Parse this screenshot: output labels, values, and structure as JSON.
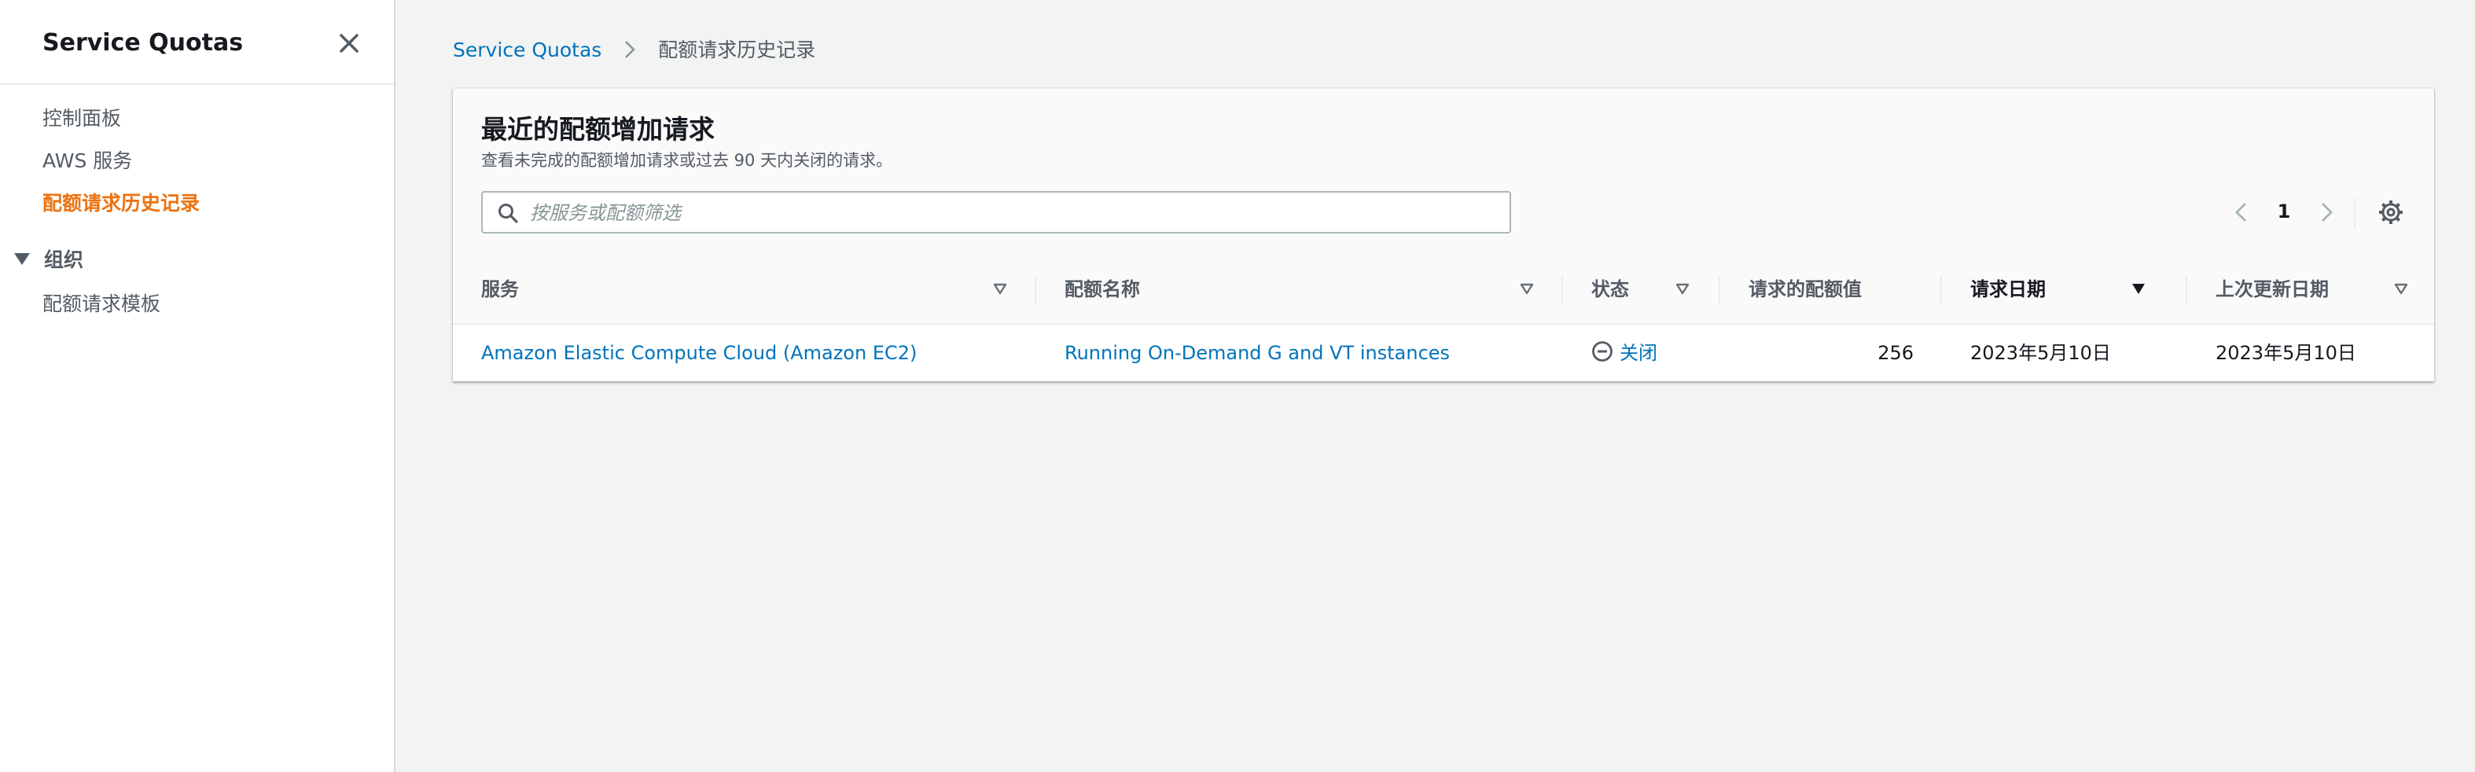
{
  "sidebar": {
    "title": "Service Quotas",
    "links": [
      "控制面板",
      "AWS 服务",
      "配额请求历史记录"
    ],
    "active_index": 2,
    "group_label": "组织",
    "group_links": [
      "配额请求模板"
    ]
  },
  "breadcrumb": {
    "root": "Service Quotas",
    "current": "配额请求历史记录"
  },
  "panel": {
    "title": "最近的配额增加请求",
    "description": "查看未完成的配额增加请求或过去 90 天内关闭的请求。",
    "search_placeholder": "按服务或配额筛选",
    "search_value": "",
    "page": "1"
  },
  "table": {
    "columns": [
      "服务",
      "配额名称",
      "状态",
      "请求的配额值",
      "请求日期",
      "上次更新日期"
    ],
    "sorted_column": "请求日期",
    "rows": [
      {
        "service": "Amazon Elastic Compute Cloud (Amazon EC2)",
        "quota_name": "Running On-Demand G and VT instances",
        "status": "关闭",
        "requested_value": "256",
        "request_date": "2023年5月10日",
        "last_updated": "2023年5月10日"
      }
    ]
  },
  "colors": {
    "link": "#0073bb",
    "active_nav": "#ec7211",
    "muted_text": "#545b64",
    "background": "#f2f3f3"
  },
  "icons": [
    "close-icon",
    "chevron-right-icon",
    "caret-down-icon",
    "search-icon",
    "chevron-left-icon",
    "gear-icon",
    "sort-icon",
    "status-closed-icon"
  ]
}
